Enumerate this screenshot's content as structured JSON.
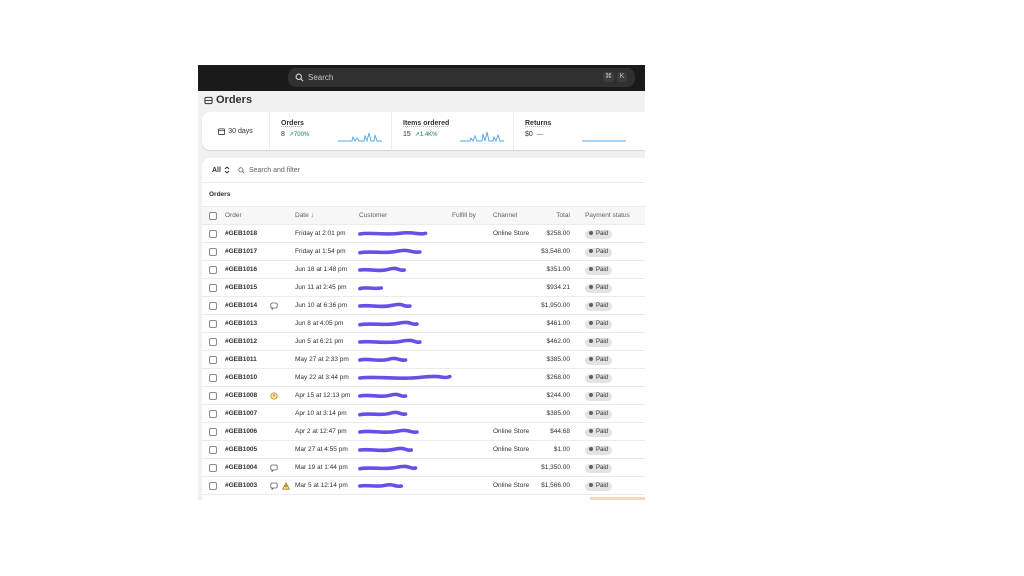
{
  "search": {
    "placeholder": "Search",
    "shortcut": [
      "⌘",
      "K"
    ]
  },
  "page": {
    "title": "Orders"
  },
  "metrics": {
    "date_range": "30 days",
    "orders": {
      "label": "Orders",
      "value": "8",
      "change": "↗700%"
    },
    "items": {
      "label": "Items ordered",
      "value": "15",
      "change": "↗1.4K%"
    },
    "returns": {
      "label": "Returns",
      "value": "$0",
      "change": "—"
    },
    "colors": {
      "sparkline": "#4aa8e8",
      "positive": "#1a7a4a"
    }
  },
  "filter": {
    "view": "All",
    "placeholder": "Search and filter"
  },
  "table": {
    "caption": "Orders",
    "headers": {
      "order": "Order",
      "date": "Date ↓",
      "customer": "Customer",
      "fulfill_by": "Fulfill by",
      "channel": "Channel",
      "total": "Total",
      "payment": "Payment status"
    },
    "redaction_color": "#6a4ee8",
    "rows": [
      {
        "order": "#GEB1018",
        "date": "Friday at 2:01 pm",
        "channel": "Online Store",
        "total": "$258.00",
        "payment": "Paid",
        "icon": ""
      },
      {
        "order": "#GEB1017",
        "date": "Friday at 1:54 pm",
        "channel": "",
        "total": "$3,548.00",
        "payment": "Paid",
        "icon": ""
      },
      {
        "order": "#GEB1016",
        "date": "Jun 18 at 1:48 pm",
        "channel": "",
        "total": "$351.00",
        "payment": "Paid",
        "icon": ""
      },
      {
        "order": "#GEB1015",
        "date": "Jun 11 at 2:45 pm",
        "channel": "",
        "total": "$934.21",
        "payment": "Paid",
        "icon": ""
      },
      {
        "order": "#GEB1014",
        "date": "Jun 10 at 6:36 pm",
        "channel": "",
        "total": "$1,950.00",
        "payment": "Paid",
        "icon": "note-icon"
      },
      {
        "order": "#GEB1013",
        "date": "Jun 8 at 4:05 pm",
        "channel": "",
        "total": "$461.00",
        "payment": "Paid",
        "icon": ""
      },
      {
        "order": "#GEB1012",
        "date": "Jun 5 at 6:21 pm",
        "channel": "",
        "total": "$462.00",
        "payment": "Paid",
        "icon": ""
      },
      {
        "order": "#GEB1011",
        "date": "May 27 at 2:33 pm",
        "channel": "",
        "total": "$385.00",
        "payment": "Paid",
        "icon": ""
      },
      {
        "order": "#GEB1010",
        "date": "May 22 at 3:44 pm",
        "channel": "",
        "total": "$268.00",
        "payment": "Paid",
        "icon": ""
      },
      {
        "order": "#GEB1008",
        "date": "Apr 15 at 12:13 pm",
        "channel": "",
        "total": "$244.00",
        "payment": "Paid",
        "icon": "risk-icon"
      },
      {
        "order": "#GEB1007",
        "date": "Apr 10 at 3:14 pm",
        "channel": "",
        "total": "$385.00",
        "payment": "Paid",
        "icon": ""
      },
      {
        "order": "#GEB1006",
        "date": "Apr 2 at 12:47 pm",
        "channel": "Online Store",
        "total": "$44.68",
        "payment": "Paid",
        "icon": ""
      },
      {
        "order": "#GEB1005",
        "date": "Mar 27 at 4:55 pm",
        "channel": "Online Store",
        "total": "$1.00",
        "payment": "Paid",
        "icon": ""
      },
      {
        "order": "#GEB1004",
        "date": "Mar 19 at 1:44 pm",
        "channel": "",
        "total": "$1,350.00",
        "payment": "Paid",
        "icon": "note-icon"
      },
      {
        "order": "#GEB1003",
        "date": "Mar 5 at 12:14 pm",
        "channel": "Online Store",
        "total": "$1,566.00",
        "payment": "Paid",
        "icon": "note-and-warning-icons"
      }
    ]
  }
}
